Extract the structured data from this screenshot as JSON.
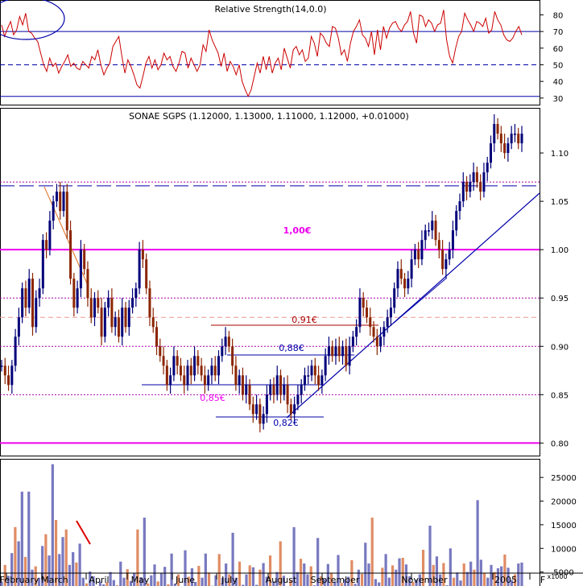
{
  "chart_data": [
    {
      "panel": "indicator",
      "type": "line",
      "title": "Relative Strength(14,0.0)",
      "y_ticks": [
        30,
        40,
        50,
        60,
        70,
        80
      ],
      "ylim": [
        27,
        87
      ],
      "hlines": [
        {
          "value": 70,
          "color": "#0000aa",
          "style": "solid"
        },
        {
          "value": 50,
          "color": "#0000aa",
          "style": "dashed"
        },
        {
          "value": 31,
          "color": "#0000aa",
          "style": "solid"
        }
      ],
      "series": [
        {
          "color": "#cc0000",
          "values": [
            74,
            67,
            72,
            76,
            68,
            71,
            79,
            74,
            81,
            70,
            69,
            66,
            64,
            57,
            50,
            46,
            54,
            49,
            51,
            45,
            49,
            52,
            56,
            49,
            51,
            48,
            47,
            52,
            50,
            48,
            55,
            53,
            59,
            50,
            44,
            48,
            51,
            61,
            64,
            67,
            55,
            45,
            53,
            49,
            44,
            38,
            36,
            43,
            51,
            55,
            48,
            53,
            47,
            50,
            57,
            53,
            55,
            49,
            46,
            51,
            58,
            57,
            48,
            54,
            50,
            46,
            50,
            62,
            58,
            71,
            65,
            61,
            57,
            49,
            57,
            46,
            52,
            49,
            44,
            50,
            40,
            35,
            31,
            35,
            43,
            51,
            45,
            55,
            47,
            55,
            45,
            51,
            54,
            47,
            60,
            54,
            48,
            59,
            61,
            56,
            59,
            52,
            54,
            67,
            63,
            55,
            69,
            67,
            63,
            61,
            73,
            72,
            66,
            56,
            59,
            52,
            63,
            70,
            73,
            77,
            68,
            66,
            61,
            70,
            56,
            71,
            59,
            73,
            66,
            72,
            75,
            76,
            72,
            70,
            74,
            76,
            82,
            69,
            63,
            80,
            79,
            73,
            77,
            75,
            70,
            74,
            75,
            83,
            65,
            55,
            51,
            60,
            67,
            70,
            81,
            77,
            74,
            70,
            76,
            75,
            73,
            78,
            69,
            71,
            82,
            77,
            74,
            68,
            65,
            64,
            66,
            70,
            73,
            68
          ]
        }
      ]
    },
    {
      "panel": "price",
      "type": "ohlc",
      "title": "SONAE SGPS (1.12000, 1.13000, 1.11000, 1.12000, +0.01000)",
      "y_ticks": [
        "0.80",
        "0.85",
        "0.90",
        "0.95",
        "1.00",
        "1.05",
        "1.10"
      ],
      "ylim": [
        0.787,
        1.145
      ],
      "bar_colors": {
        "up": "#00007a",
        "down": "#8b2500"
      },
      "series": [
        {
          "name": "SONAE SGPS",
          "closes": [
            0.88,
            0.87,
            0.86,
            0.88,
            0.91,
            0.93,
            0.96,
            0.94,
            0.97,
            0.92,
            0.95,
            0.96,
            1.01,
            1.0,
            1.03,
            1.05,
            1.06,
            1.04,
            1.06,
            1.02,
            0.97,
            0.94,
            0.96,
            1.0,
            0.98,
            0.95,
            0.93,
            0.95,
            0.94,
            0.91,
            0.94,
            0.95,
            0.92,
            0.93,
            0.91,
            0.94,
            0.92,
            0.94,
            0.95,
            0.96,
            1.0,
            0.99,
            0.96,
            0.93,
            0.92,
            0.9,
            0.89,
            0.88,
            0.86,
            0.87,
            0.89,
            0.88,
            0.87,
            0.86,
            0.88,
            0.87,
            0.89,
            0.88,
            0.87,
            0.86,
            0.87,
            0.88,
            0.87,
            0.89,
            0.9,
            0.91,
            0.9,
            0.88,
            0.86,
            0.87,
            0.85,
            0.86,
            0.84,
            0.83,
            0.84,
            0.82,
            0.83,
            0.85,
            0.86,
            0.85,
            0.87,
            0.85,
            0.86,
            0.84,
            0.83,
            0.84,
            0.85,
            0.86,
            0.87,
            0.87,
            0.88,
            0.87,
            0.86,
            0.87,
            0.89,
            0.9,
            0.89,
            0.9,
            0.89,
            0.9,
            0.88,
            0.9,
            0.91,
            0.92,
            0.95,
            0.94,
            0.93,
            0.92,
            0.91,
            0.9,
            0.91,
            0.92,
            0.93,
            0.94,
            0.96,
            0.98,
            0.97,
            0.96,
            0.97,
            0.99,
            1.0,
            0.99,
            1.01,
            1.02,
            1.02,
            1.03,
            1.01,
            1.0,
            0.98,
            0.99,
            1.0,
            1.02,
            1.04,
            1.05,
            1.07,
            1.06,
            1.07,
            1.08,
            1.07,
            1.06,
            1.08,
            1.09,
            1.11,
            1.13,
            1.12,
            1.11,
            1.1,
            1.11,
            1.12,
            1.12,
            1.11,
            1.12
          ]
        }
      ],
      "hlines": [
        {
          "value": 1.0,
          "color": "#ee00ee",
          "style": "solid",
          "label": "1,00€"
        },
        {
          "value": 0.8,
          "color": "#ee00ee",
          "style": "solid"
        },
        {
          "value": 1.066,
          "color": "#0000aa",
          "style": "long-dash"
        },
        {
          "value": 1.07,
          "color": "#aa00aa",
          "style": "dotted"
        },
        {
          "value": 0.95,
          "color": "#aa00aa",
          "style": "dotted"
        },
        {
          "value": 0.93,
          "color": "#ee9999",
          "style": "dashed"
        },
        {
          "value": 0.9,
          "color": "#aa00aa",
          "style": "dotted"
        },
        {
          "value": 0.85,
          "color": "#aa00aa",
          "style": "dotted"
        }
      ],
      "annotations": [
        "0,91€",
        "0,88€",
        "0,85€",
        "0,82€"
      ]
    },
    {
      "panel": "volume",
      "type": "bar",
      "y_ticks": [
        "5000",
        "10000",
        "15000",
        "20000",
        "25000"
      ],
      "ylim": [
        0,
        28600
      ],
      "y_unit": "x1000",
      "series": [
        {
          "name": "Volume",
          "values": [
            3000,
            6500,
            4200,
            9000,
            14500,
            11500,
            22000,
            8200,
            22000,
            5500,
            6200,
            3800,
            10500,
            13000,
            8500,
            27800,
            16000,
            8800,
            12400,
            14000,
            6500,
            9200,
            7000,
            11000,
            3800,
            2600,
            5100,
            4100,
            2000,
            3000,
            2400,
            2800,
            5000,
            3300,
            2200,
            7200,
            3800,
            5600,
            3100,
            4800,
            14000,
            3900,
            16500,
            2600,
            4300,
            6600,
            3000,
            4700,
            6100,
            2400,
            8900,
            2500,
            4500,
            1700,
            9600,
            4000,
            5800,
            2900,
            6300,
            3800,
            8900,
            4900,
            2100,
            4300,
            8800,
            3800,
            6800,
            4500,
            13300,
            3800,
            7200,
            2300,
            4500,
            6400,
            6000,
            2300,
            5500,
            6900,
            4000,
            8500,
            3000,
            5000,
            11500,
            4200,
            1700,
            3300,
            14500,
            5000,
            7800,
            6800,
            4500,
            6200,
            2200,
            12200,
            4100,
            3500,
            6700,
            4800,
            3000,
            8600,
            2700,
            3500,
            4000,
            7500,
            2500,
            5500,
            4600,
            11200,
            6800,
            16500,
            3500,
            2800,
            5900,
            8800,
            3800,
            6400,
            5500,
            7900,
            8000,
            6600,
            4100,
            2900,
            3400,
            4500,
            9700,
            2000,
            14800,
            6500,
            8300,
            4500,
            6900,
            2200,
            10000,
            3800,
            4900,
            3200,
            6800,
            5000,
            7200,
            5500,
            20200,
            7600,
            4700,
            3800,
            6500,
            5000,
            5800,
            6200,
            8700,
            5900,
            3300,
            4500,
            6800,
            7000
          ]
        }
      ]
    }
  ],
  "x_axis": {
    "labels": [
      "February",
      "March",
      "April",
      "May",
      "June",
      "July",
      "August",
      "September",
      "November",
      "2005",
      "F"
    ]
  },
  "colors": {
    "volume_a": "#7878c0",
    "volume_b": "#e08c64",
    "support_line": "#0000aa",
    "resistance_line": "#ee00ee"
  }
}
